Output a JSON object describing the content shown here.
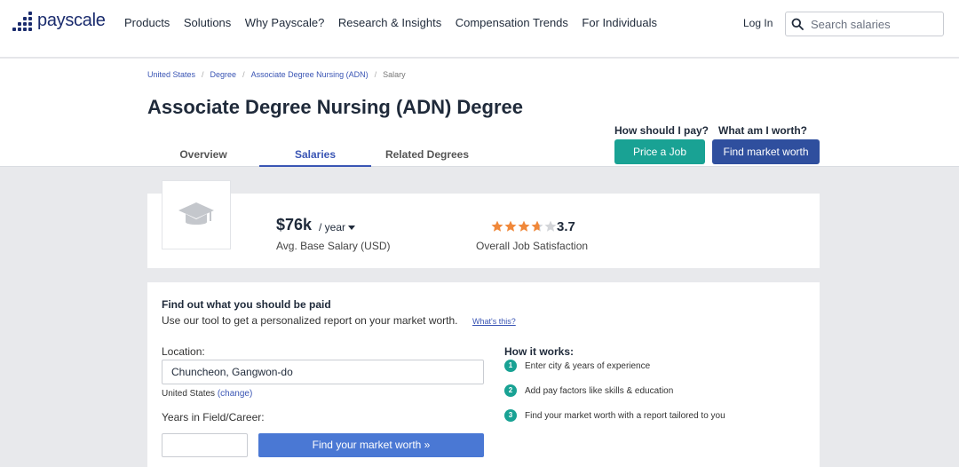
{
  "brand": {
    "name": "payscale"
  },
  "nav": {
    "links": [
      "Products",
      "Solutions",
      "Why Payscale?",
      "Research & Insights",
      "Compensation Trends",
      "For Individuals"
    ],
    "login": "Log In",
    "search_placeholder": "Search salaries"
  },
  "breadcrumb": [
    "United States",
    "Degree",
    "Associate Degree Nursing (ADN)",
    "Salary"
  ],
  "page_title": "Associate Degree Nursing (ADN) Degree",
  "tabs": [
    {
      "label": "Overview",
      "active": false
    },
    {
      "label": "Salaries",
      "active": true
    },
    {
      "label": "Related Degrees",
      "active": false
    }
  ],
  "cta": {
    "pay_question": "How should I pay?",
    "price_job": "Price a Job",
    "worth_question": "What am I worth?",
    "find_worth": "Find market worth"
  },
  "summary": {
    "salary": "$76k",
    "period": "/ year",
    "salary_caption": "Avg. Base Salary (USD)",
    "rating": "3.7",
    "rating_value": 3.7,
    "rating_max": 5,
    "rating_caption": "Overall Job Satisfaction",
    "icon": "graduation-cap-icon"
  },
  "tool": {
    "title": "Find out what you should be paid",
    "subtitle": "Use our tool to get a personalized report on your market worth.",
    "whats_this": "What's this?",
    "location_label": "Location:",
    "location_value": "Chuncheon, Gangwon-do",
    "country": "United States",
    "country_change": "(change)",
    "years_label": "Years in Field/Career:",
    "years_value": "",
    "submit": "Find your market worth »",
    "how_title": "How it works:",
    "steps": [
      "Enter city & years of experience",
      "Add pay factors like skills & education",
      "Find your market worth with a report tailored to you"
    ]
  },
  "colors": {
    "teal": "#19a294",
    "navy": "#2f4f9e",
    "link": "#3a55b4",
    "star": "#f0883a"
  }
}
